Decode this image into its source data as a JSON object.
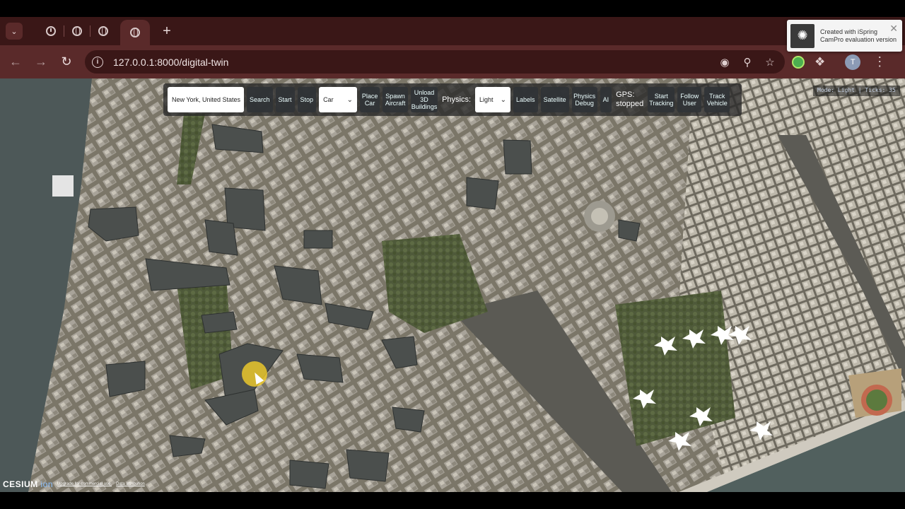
{
  "browser": {
    "tabs": [
      {
        "icon": "timer-icon",
        "active": false
      },
      {
        "icon": "globe-icon",
        "active": false
      },
      {
        "icon": "globe-icon",
        "active": false
      },
      {
        "icon": "globe-icon",
        "active": true
      }
    ],
    "new_tab_label": "+",
    "url": "127.0.0.1:8000/digital-twin",
    "profile_initial": "T"
  },
  "ispring": {
    "line1": "Created with iSpring",
    "line2": "CamPro evaluation version"
  },
  "toolbar": {
    "search_value": "New York, United States",
    "search_label": "Search",
    "start_label": "Start",
    "stop_label": "Stop",
    "vehicle_selected": "Car",
    "place_car_label": "Place Car",
    "spawn_aircraft_label": "Spawn Aircraft",
    "unload_buildings_label": "Unload 3D Buildings",
    "physics_label": "Physics:",
    "physics_selected": "Light",
    "labels_label": "Labels",
    "satellite_label": "Satellite",
    "physics_debug_label": "Physics Debug",
    "ai_label": "AI",
    "gps_label": "GPS:",
    "gps_status": "stopped",
    "start_tracking_label": "Start Tracking",
    "follow_user_label": "Follow User",
    "track_vehicle_label": "Track Vehicle"
  },
  "status": {
    "text": "Mode: Light | Ticks: 35"
  },
  "credits": {
    "logo": "CESIUM",
    "logo_suffix": "ion",
    "upgrade": "Upgrade for commercial use.",
    "attribution": "Data attribution"
  },
  "colors": {
    "tab_strip": "#3a1717",
    "address_row": "#5a2a2a",
    "toolbar_bg": "#282828",
    "water": "#4e5a5a"
  }
}
